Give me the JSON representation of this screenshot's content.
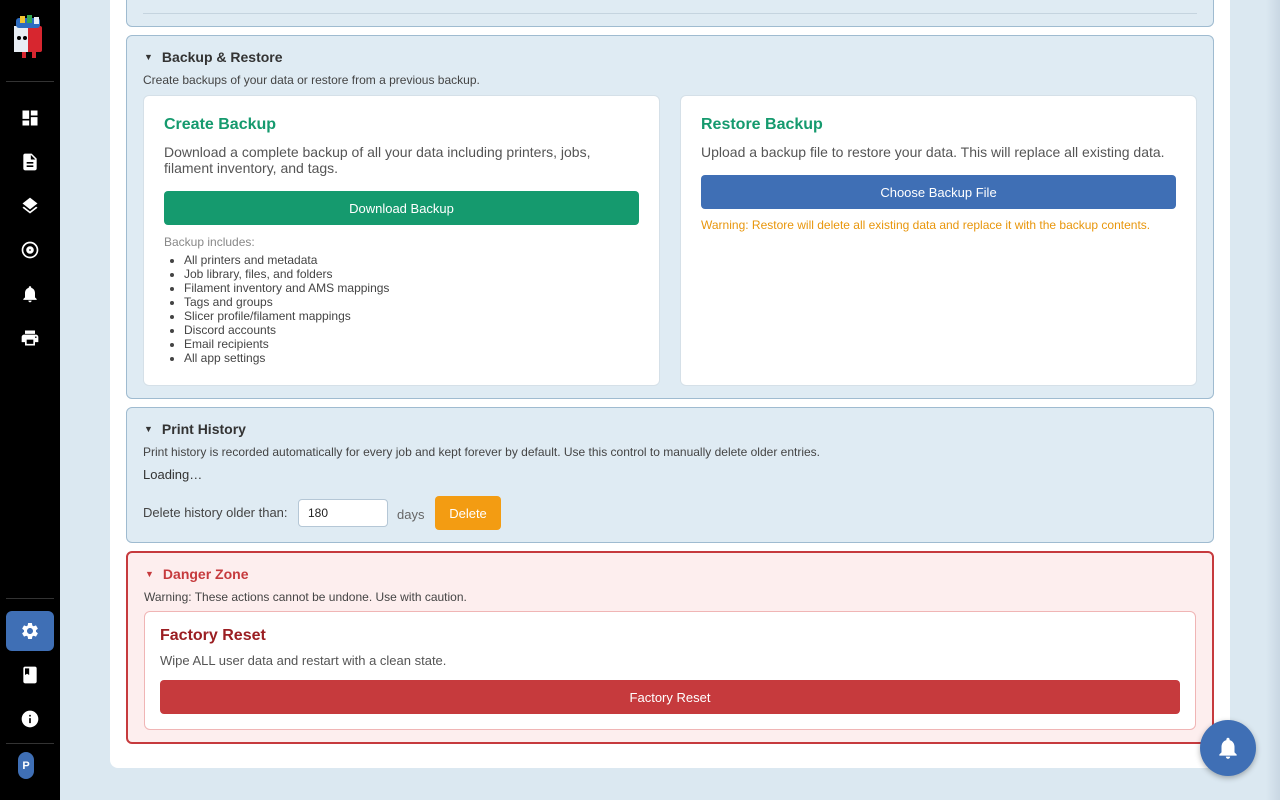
{
  "sidebar": {
    "items": [
      {
        "name": "dashboard-icon"
      },
      {
        "name": "document-icon"
      },
      {
        "name": "layers-icon"
      },
      {
        "name": "filament-spool-icon"
      },
      {
        "name": "bell-icon"
      },
      {
        "name": "printer-icon"
      }
    ],
    "bottom_items": [
      {
        "name": "gear-icon",
        "active": true
      },
      {
        "name": "book-icon"
      },
      {
        "name": "info-icon"
      }
    ],
    "avatar_initial": "P"
  },
  "backup": {
    "title": "Backup & Restore",
    "description": "Create backups of your data or restore from a previous backup.",
    "create": {
      "title": "Create Backup",
      "description": "Download a complete backup of all your data including printers, jobs, filament inventory, and tags.",
      "button": "Download Backup",
      "includes_label": "Backup includes:",
      "includes": [
        "All printers and metadata",
        "Job library, files, and folders",
        "Filament inventory and AMS mappings",
        "Tags and groups",
        "Slicer profile/filament mappings",
        "Discord accounts",
        "Email recipients",
        "All app settings"
      ]
    },
    "restore": {
      "title": "Restore Backup",
      "description": "Upload a backup file to restore your data. This will replace all existing data.",
      "button": "Choose Backup File",
      "warning": "Warning: Restore will delete all existing data and replace it with the backup contents."
    }
  },
  "history": {
    "title": "Print History",
    "description": "Print history is recorded automatically for every job and kept forever by default. Use this control to manually delete older entries.",
    "status": "Loading…",
    "delete_label": "Delete history older than:",
    "days_value": "180",
    "days_unit": "days",
    "delete_button": "Delete"
  },
  "danger": {
    "title": "Danger Zone",
    "description": "Warning: These actions cannot be undone. Use with caution.",
    "reset": {
      "title": "Factory Reset",
      "description": "Wipe ALL user data and restart with a clean state.",
      "button": "Factory Reset"
    }
  },
  "colors": {
    "accent_green": "#159a6e",
    "accent_blue": "#3f6fb5",
    "warning_orange": "#f39c12",
    "danger_red": "#c63a3d"
  }
}
